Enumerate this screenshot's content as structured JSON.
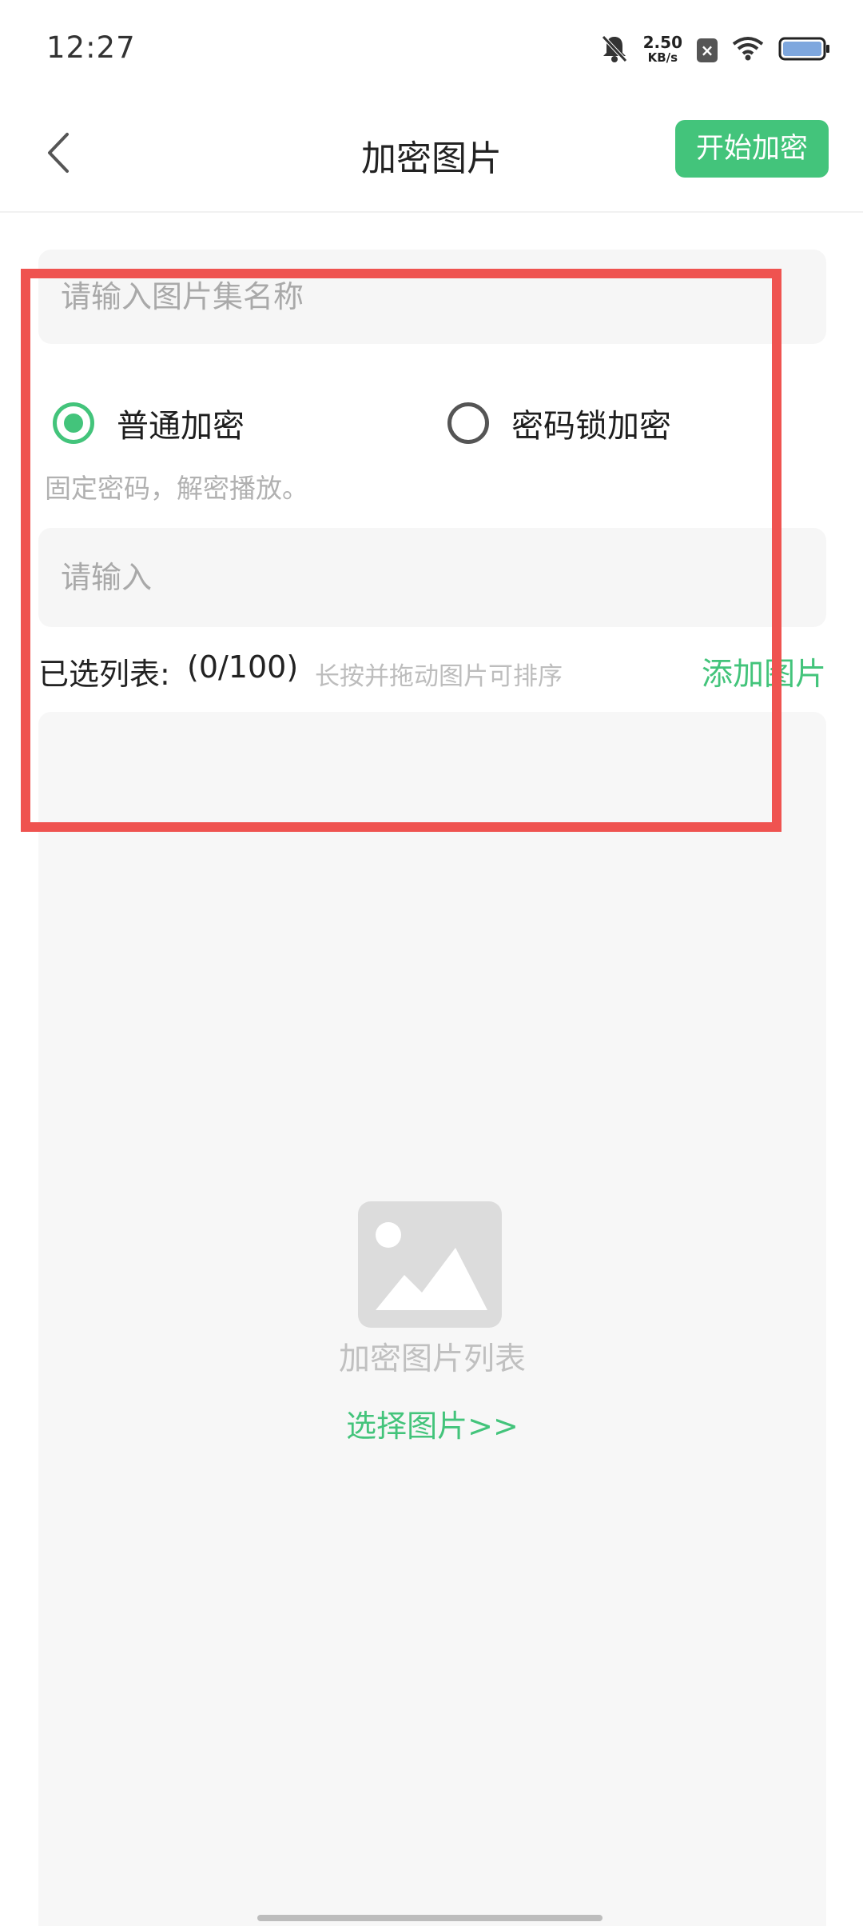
{
  "status_bar": {
    "time": "12:27",
    "net_speed_value": "2.50",
    "net_speed_unit": "KB/s",
    "icons": [
      "mute-bell-icon",
      "sim-x-icon",
      "wifi-icon",
      "battery-icon"
    ]
  },
  "header": {
    "title": "加密图片",
    "start_button": "开始加密"
  },
  "form": {
    "name_placeholder": "请输入图片集名称",
    "modes": [
      {
        "label": "普通加密",
        "selected": true
      },
      {
        "label": "密码锁加密",
        "selected": false
      }
    ],
    "mode_hint": "固定密码，解密播放。",
    "password_placeholder": "请输入"
  },
  "selected_list": {
    "label": "已选列表:",
    "count": "(0/100)",
    "tip": "长按并拖动图片可排序",
    "add_link": "添加图片"
  },
  "empty_state": {
    "text": "加密图片列表",
    "choose_link": "选择图片>>"
  },
  "colors": {
    "accent": "#43c47b",
    "highlight": "#ef5350"
  }
}
